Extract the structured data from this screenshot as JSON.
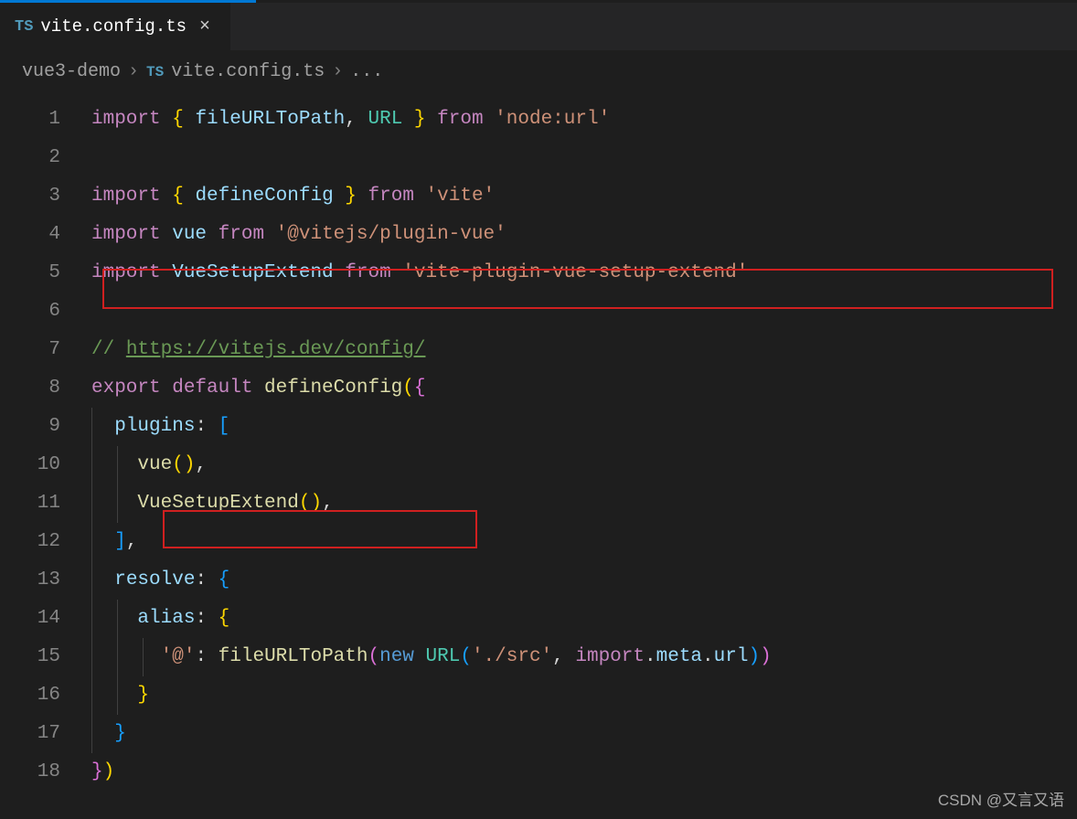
{
  "tab": {
    "icon": "TS",
    "filename": "vite.config.ts"
  },
  "breadcrumb": {
    "project": "vue3-demo",
    "icon": "TS",
    "file": "vite.config.ts",
    "tail": "..."
  },
  "gutter": [
    "1",
    "2",
    "3",
    "4",
    "5",
    "6",
    "7",
    "8",
    "9",
    "10",
    "11",
    "12",
    "13",
    "14",
    "15",
    "16",
    "17",
    "18"
  ],
  "code": {
    "l1": {
      "kw1": "import",
      "br1": "{ ",
      "id1": "fileURLToPath",
      "p1": ", ",
      "cls1": "URL",
      "br2": " }",
      "kw2": " from ",
      "str1": "'node:url'"
    },
    "l3": {
      "kw1": "import",
      "br1": "{ ",
      "id1": "defineConfig",
      "br2": " }",
      "kw2": " from ",
      "str1": "'vite'"
    },
    "l4": {
      "kw1": "import",
      "id1": " vue ",
      "kw2": "from ",
      "str1": "'@vitejs/plugin-vue'"
    },
    "l5": {
      "kw1": "import",
      "id1": " VueSetupExtend ",
      "kw2": "from ",
      "str1": "'vite-plugin-vue-setup-extend'"
    },
    "l7": {
      "c1": "// ",
      "link": "https://vitejs.dev/config/"
    },
    "l8": {
      "kw1": "export",
      "kw2": " default ",
      "fn1": "defineConfig",
      "br1": "(",
      "br2": "{"
    },
    "l9": {
      "prop": "plugins",
      "p1": ": ",
      "br": "["
    },
    "l10": {
      "fn": "vue",
      "br": "()",
      "p": ","
    },
    "l11": {
      "fn": "VueSetupExtend",
      "br": "()",
      "p": ","
    },
    "l12": {
      "br": "]",
      "p": ","
    },
    "l13": {
      "prop": "resolve",
      "p1": ": ",
      "br": "{"
    },
    "l14": {
      "prop": "alias",
      "p1": ": ",
      "br": "{"
    },
    "l15": {
      "str1": "'@'",
      "p1": ": ",
      "fn": "fileURLToPath",
      "br1": "(",
      "kw": "new ",
      "cls": "URL",
      "br2": "(",
      "str2": "'./src'",
      "p2": ", ",
      "kw2": "import",
      "p3": ".",
      "id1": "meta",
      "p4": ".",
      "id2": "url",
      "br3": ")",
      ")b": ")"
    },
    "l16": {
      "br": "}"
    },
    "l17": {
      "br": "}"
    },
    "l18": {
      "br1": "}",
      "br2": ")"
    }
  },
  "watermark": "CSDN @又言又语"
}
